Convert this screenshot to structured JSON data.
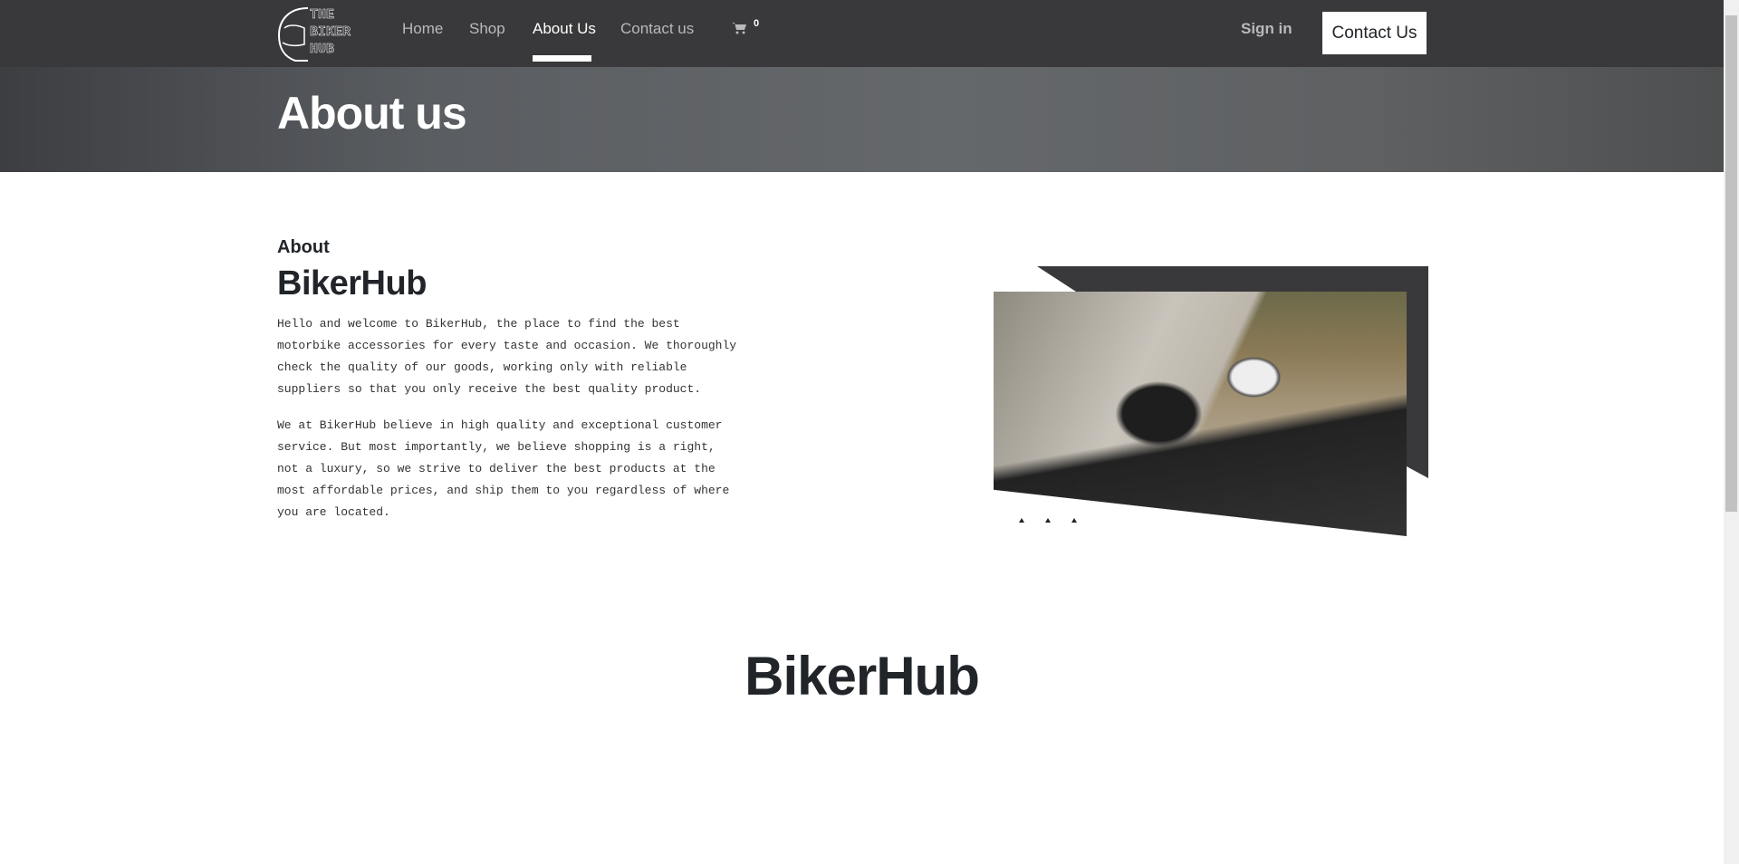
{
  "header": {
    "logo_text": "THE BIKER HUB",
    "nav": [
      {
        "label": "Home",
        "active": false
      },
      {
        "label": "Shop",
        "active": false
      },
      {
        "label": "About Us",
        "active": true
      },
      {
        "label": "Contact us",
        "active": false
      }
    ],
    "cart_icon": "shopping-cart-icon",
    "cart_count": "0",
    "sign_in": "Sign in",
    "contact_button": "Contact Us"
  },
  "hero": {
    "title": "About us"
  },
  "about": {
    "label": "About",
    "title": "BikerHub",
    "paragraphs": [
      "Hello and welcome to BikerHub, the place to find the best\nmotorbike accessories for every taste and occasion. We thoroughly\ncheck the quality of our goods, working only with reliable\nsuppliers so that you only receive the best quality product.",
      "We at BikerHub believe in high quality and exceptional customer\nservice. But most importantly, we believe shopping is a right,\nnot a luxury, so we strive to deliver the best products at the\nmost affordable prices, and ship them to you regardless of where\nyou are located."
    ]
  },
  "section2": {
    "title": "BikerHub"
  },
  "colors": {
    "header_bg": "#39393b",
    "text": "#212529",
    "nav_inactive": "#b9b9bb"
  }
}
